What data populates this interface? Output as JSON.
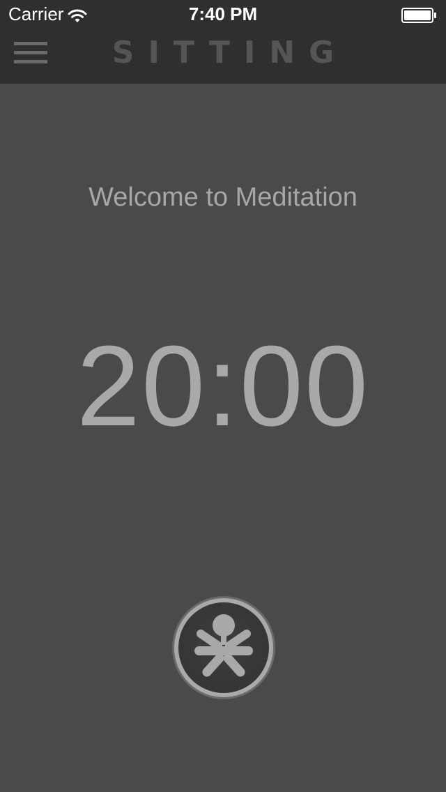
{
  "status_bar": {
    "carrier": "Carrier",
    "time": "7:40 PM",
    "wifi_icon": "wifi-icon",
    "battery_icon": "battery-icon"
  },
  "nav": {
    "menu_icon": "hamburger-menu-icon",
    "title": "SITTING"
  },
  "main": {
    "welcome": "Welcome to Meditation",
    "timer": "20:00",
    "start_icon": "meditation-figure-icon"
  },
  "colors": {
    "background": "#4a4a4a",
    "navbar": "#2f2f2f",
    "text_muted": "#a7a7a7"
  }
}
